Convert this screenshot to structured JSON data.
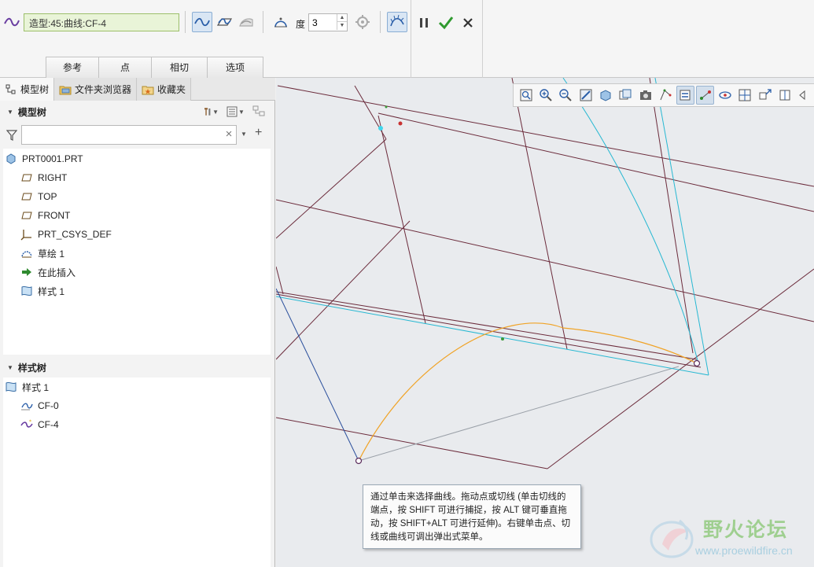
{
  "dashboard": {
    "curve_name": "造型:45:曲线:CF-4",
    "degree_label": "度",
    "degree_value": "3",
    "tabs": [
      {
        "label": "参考"
      },
      {
        "label": "点"
      },
      {
        "label": "相切"
      },
      {
        "label": "选项"
      }
    ],
    "pause_icon": "pause-icon",
    "ok_icon": "checkmark-icon",
    "cancel_icon": "close-icon"
  },
  "navigator": {
    "tabs": [
      {
        "label": "模型树",
        "icon": "model-tree-icon"
      },
      {
        "label": "文件夹浏览器",
        "icon": "folder-browser-icon"
      },
      {
        "label": "收藏夹",
        "icon": "favorites-icon"
      }
    ],
    "model_tree_title": "模型树",
    "search_placeholder": "",
    "model_tree_items": [
      {
        "label": "PRT0001.PRT",
        "icon": "part-icon"
      },
      {
        "label": "RIGHT",
        "icon": "datum-plane-icon"
      },
      {
        "label": "TOP",
        "icon": "datum-plane-icon"
      },
      {
        "label": "FRONT",
        "icon": "datum-plane-icon"
      },
      {
        "label": "PRT_CSYS_DEF",
        "icon": "coordinate-system-icon"
      },
      {
        "label": "草绘 1",
        "icon": "sketch-icon"
      },
      {
        "label": "在此插入",
        "icon": "insert-here-arrow-icon"
      },
      {
        "label": "样式 1",
        "icon": "style-feature-icon"
      }
    ],
    "style_tree_title": "样式树",
    "style_tree_items": [
      {
        "label": "样式 1",
        "icon": "style-feature-icon"
      },
      {
        "label": "CF-0",
        "icon": "free-curve-icon"
      },
      {
        "label": "CF-4",
        "icon": "active-curve-icon"
      }
    ]
  },
  "graphics": {
    "tooltip": "通过单击来选择曲线。拖动点或切线 (单击切线的端点，按 SHIFT 可进行捕捉，按 ALT 键可垂直拖动，按 SHIFT+ALT 可进行延伸)。右键单击点、切线或曲线可调出弹出式菜单。",
    "colors": {
      "datum_lines": "#6b2b3b",
      "cyan_curve": "#27b8d2",
      "orange_curve": "#f0a326",
      "blue_curve": "#2a4f9c",
      "grey_line": "#9aa0a8"
    }
  },
  "watermark": {
    "title": "野火论坛",
    "url": "www.proewildfire.cn"
  }
}
